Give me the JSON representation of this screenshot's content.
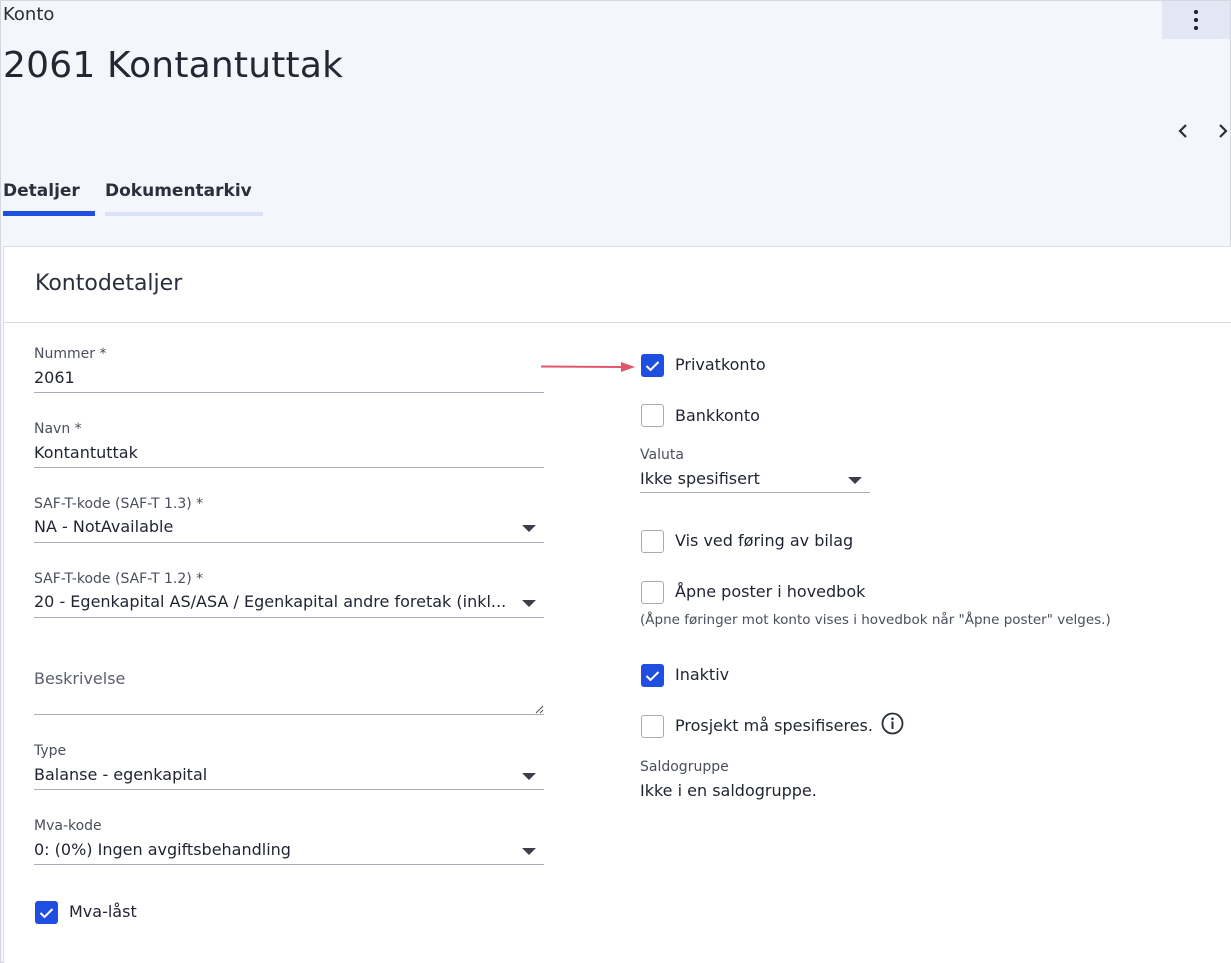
{
  "header": {
    "breadcrumb": "Konto",
    "title": "2061 Kontantuttak",
    "menu_icon": "more-vertical-icon",
    "prev_icon": "chevron-left-icon",
    "next_icon": "chevron-right-icon"
  },
  "tabs": [
    {
      "label": "Detaljer",
      "active": true
    },
    {
      "label": "Dokumentarkiv",
      "active": false
    }
  ],
  "colors": {
    "accent": "#1f4fe0",
    "tab_inactive_underline": "#dde2f8",
    "annotation_arrow": "#e0566a"
  },
  "card": {
    "title": "Kontodetaljer",
    "left": {
      "nummer": {
        "label": "Nummer *",
        "value": "2061"
      },
      "navn": {
        "label": "Navn *",
        "value": "Kontantuttak"
      },
      "saft13": {
        "label": "SAF-T-kode (SAF-T 1.3) *",
        "value": "NA - NotAvailable"
      },
      "saft12": {
        "label": "SAF-T-kode (SAF-T 1.2) *",
        "value": "20 - Egenkapital AS/ASA / Egenkapital andre foretak (inkl..."
      },
      "beskrivelse": {
        "placeholder": "Beskrivelse",
        "value": ""
      },
      "type": {
        "label": "Type",
        "value": "Balanse - egenkapital"
      },
      "mvakode": {
        "label": "Mva-kode",
        "value": "0: (0%) Ingen avgiftsbehandling"
      },
      "mvalast": {
        "label": "Mva-låst",
        "checked": true
      }
    },
    "right": {
      "privatkonto": {
        "label": "Privatkonto",
        "checked": true
      },
      "bankkonto": {
        "label": "Bankkonto",
        "checked": false
      },
      "valuta": {
        "label": "Valuta",
        "value": "Ikke spesifisert"
      },
      "vis_ved_foring": {
        "label": "Vis ved føring av bilag",
        "checked": false
      },
      "apne_poster": {
        "label": "Åpne poster i hovedbok",
        "checked": false,
        "hint": "(Åpne føringer mot konto vises i hovedbok når \"Åpne poster\" velges.)"
      },
      "inaktiv": {
        "label": "Inaktiv",
        "checked": true
      },
      "prosjekt": {
        "label": "Prosjekt må spesifiseres.",
        "checked": false,
        "info_icon": "info-icon"
      },
      "saldogruppe": {
        "label": "Saldogruppe",
        "value": "Ikke i en saldogruppe."
      }
    }
  }
}
